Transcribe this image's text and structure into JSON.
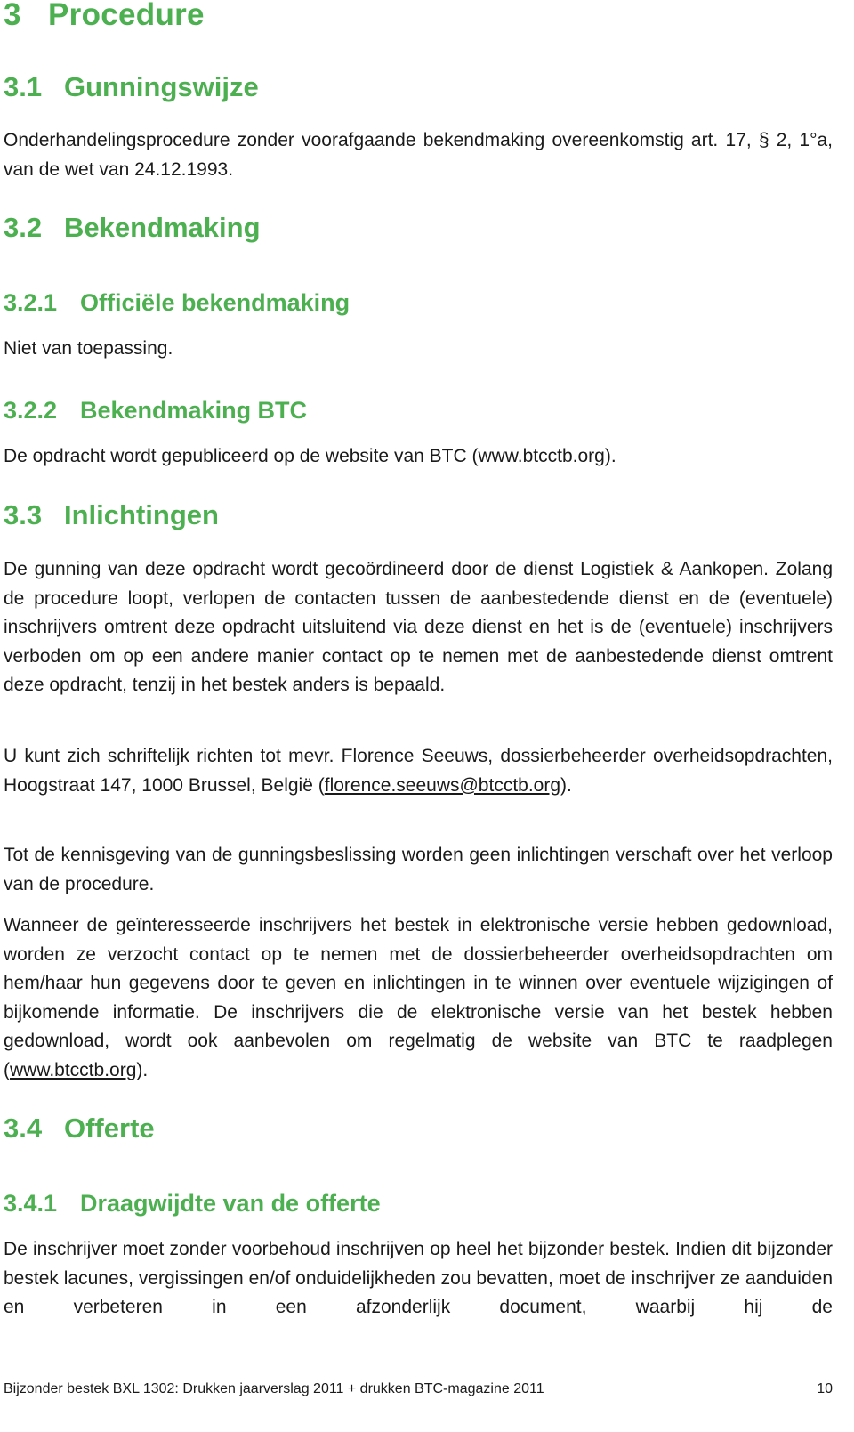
{
  "accent_color": "#4caf50",
  "sections": {
    "s3": {
      "number": "3",
      "title": "Procedure"
    },
    "s3_1": {
      "number": "3.1",
      "title": "Gunningswijze",
      "body": "Onderhandelingsprocedure zonder voorafgaande bekendmaking overeenkomstig  art. 17, § 2, 1°a, van de wet van 24.12.1993."
    },
    "s3_2": {
      "number": "3.2",
      "title": "Bekendmaking"
    },
    "s3_2_1": {
      "number": "3.2.1",
      "title": "Officiële bekendmaking",
      "body": "Niet van toepassing."
    },
    "s3_2_2": {
      "number": "3.2.2",
      "title": "Bekendmaking BTC",
      "body": "De opdracht wordt gepubliceerd op de website van BTC (www.btcctb.org)."
    },
    "s3_3": {
      "number": "3.3",
      "title": "Inlichtingen",
      "p1": "De gunning van deze opdracht wordt gecoördineerd door de dienst Logistiek & Aankopen. Zolang de procedure loopt, verlopen de contacten tussen de aanbestedende dienst en de (eventuele) inschrijvers omtrent deze opdracht uitsluitend via deze dienst en het is de (eventuele) inschrijvers verboden om op een andere manier contact op te nemen met de aanbestedende dienst omtrent deze opdracht, tenzij in het bestek anders is bepaald.",
      "p2_text": "U kunt zich schriftelijk richten tot mevr. Florence Seeuws, dossierbeheerder overheidsopdrachten, Hoogstraat 147, 1000 Brussel, België",
      "p2_open": "(",
      "p2_email": "florence.seeuws@btcctb.org",
      "p2_close": ").",
      "p3": "Tot de kennisgeving van de gunningsbeslissing worden geen inlichtingen verschaft over het verloop van de procedure.",
      "p4_text": "Wanneer de geïnteresseerde inschrijvers het bestek in elektronische versie hebben gedownload, worden ze verzocht contact op te nemen met de dossierbeheerder overheidsopdrachten om hem/haar hun gegevens door te geven en inlichtingen in te winnen over eventuele wijzigingen of bijkomende informatie. De inschrijvers die de elektronische versie van het bestek hebben gedownload, wordt ook aanbevolen om regelmatig de website van BTC te raadplegen (",
      "p4_link": "www.btcctb.org",
      "p4_close": ")."
    },
    "s3_4": {
      "number": "3.4",
      "title": "Offerte"
    },
    "s3_4_1": {
      "number": "3.4.1",
      "title": "Draagwijdte van de offerte",
      "body": "De inschrijver moet zonder voorbehoud inschrijven op heel het bijzonder bestek. Indien dit bijzonder bestek lacunes, vergissingen en/of onduidelijkheden zou bevatten, moet de inschrijver ze aanduiden en verbeteren in een afzonderlijk document, waarbij hij de"
    }
  },
  "footer": {
    "title": "Bijzonder bestek BXL 1302: Drukken jaarverslag 2011 + drukken BTC-magazine 2011",
    "page_number": "10"
  }
}
